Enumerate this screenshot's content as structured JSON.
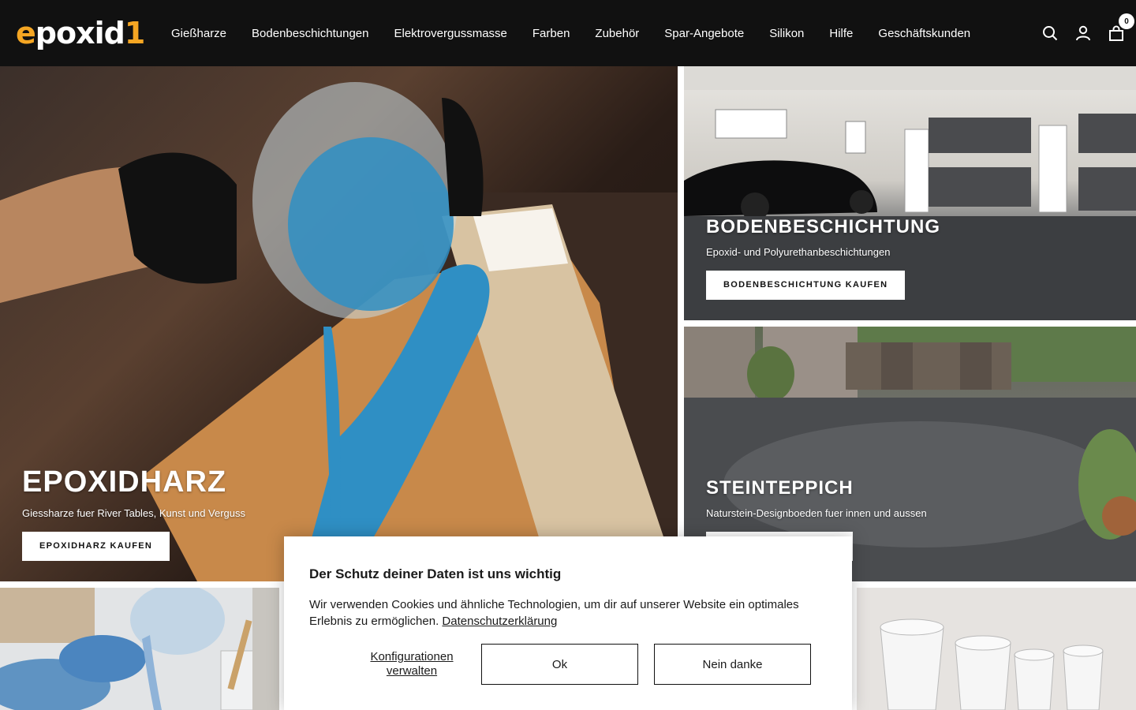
{
  "header": {
    "logo": {
      "part1": "e",
      "part2": "p",
      "part3": "oxid",
      "part4": "1"
    },
    "nav": [
      "Gießharze",
      "Bodenbeschichtungen",
      "Elektrovergussmasse",
      "Farben",
      "Zubehör",
      "Spar-Angebote",
      "Silikon",
      "Hilfe",
      "Geschäftskunden"
    ],
    "icons": [
      "search-icon",
      "account-icon",
      "cart-icon"
    ],
    "cart_count": "0"
  },
  "tiles": {
    "epoxidharz": {
      "title": "EPOXIDHARZ",
      "subtitle": "Giessharze fuer River Tables, Kunst und Verguss",
      "button": "EPOXIDHARZ KAUFEN"
    },
    "bodenbeschichtung": {
      "title": "BODENBESCHICHTUNG",
      "subtitle": "Epoxid- und Polyurethanbeschichtungen",
      "button": "BODENBESCHICHTUNG KAUFEN"
    },
    "steinteppich": {
      "title": "STEINTEPPICH",
      "subtitle": "Naturstein-Designboeden fuer innen und aussen"
    }
  },
  "cookie": {
    "title": "Der Schutz deiner Daten ist uns wichtig",
    "text": "Wir verwenden Cookies und ähnliche Technologien, um dir auf unserer Website ein optimales Erlebnis zu ermöglichen.",
    "privacy_link": "Datenschutzerklärung",
    "configure_line1": "Konfigurationen",
    "configure_line2": "verwalten",
    "ok": "Ok",
    "decline": "Nein danke"
  },
  "colors": {
    "header_bg": "#111111",
    "logo_accent": "#f5a623",
    "epoxy_blue": "#2f8fc4"
  }
}
